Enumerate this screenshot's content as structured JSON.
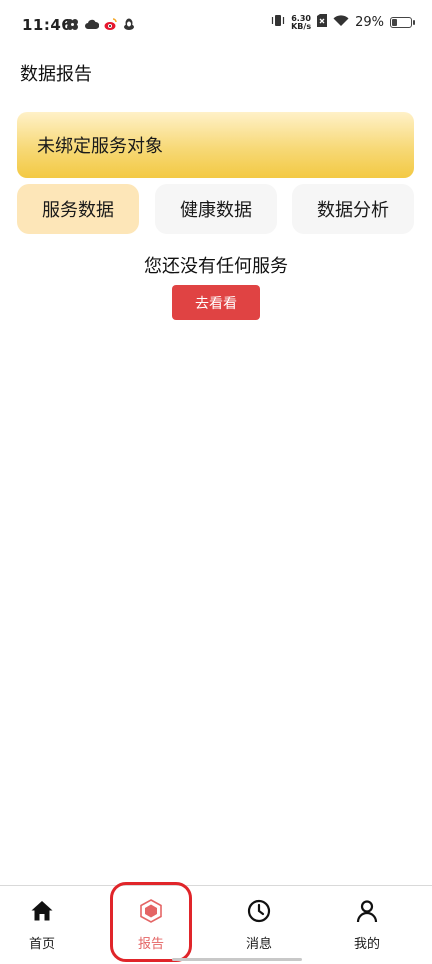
{
  "status_bar": {
    "time": "11:46",
    "net_speed_value": "6.30",
    "net_speed_unit": "KB/s",
    "battery_percent": "29%",
    "battery_level": 0.29
  },
  "header": {
    "title": "数据报告"
  },
  "banner": {
    "text": "未绑定服务对象"
  },
  "tabs": [
    {
      "label": "服务数据",
      "active": true
    },
    {
      "label": "健康数据",
      "active": false
    },
    {
      "label": "数据分析",
      "active": false
    }
  ],
  "empty_state": {
    "message": "您还没有任何服务",
    "button_label": "去看看"
  },
  "bottom_nav": {
    "items": [
      {
        "label": "首页",
        "icon": "home-icon"
      },
      {
        "label": "报告",
        "icon": "report-hexagon-icon",
        "active": true
      },
      {
        "label": "消息",
        "icon": "clock-icon"
      },
      {
        "label": "我的",
        "icon": "user-icon"
      }
    ]
  },
  "colors": {
    "accent_red": "#e04343",
    "active_tab_bg": "#fde6b8",
    "banner_gold": "#f3c943",
    "nav_active": "#e46565"
  }
}
